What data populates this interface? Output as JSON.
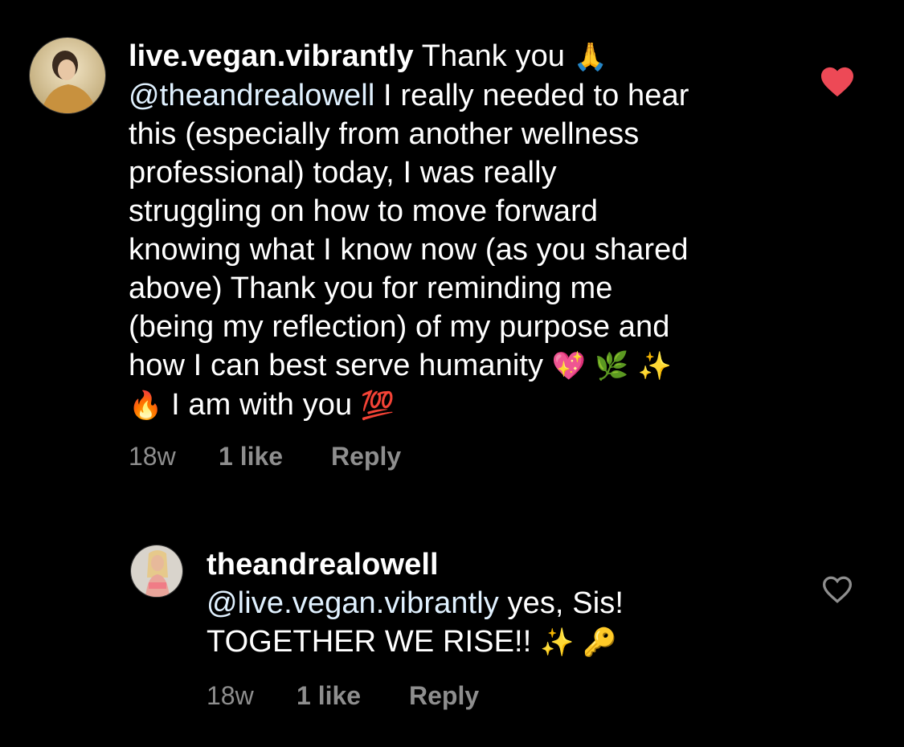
{
  "comments": [
    {
      "username": "live.vegan.vibrantly",
      "lines": [
        [
          "Thank you ",
          "🙏"
        ],
        [
          "@theandrealowell",
          " I really needed to hear"
        ],
        [
          "this (especially from another wellness"
        ],
        [
          "professional) today, I was really"
        ],
        [
          "struggling on how to move forward"
        ],
        [
          "knowing what I know now (as you shared"
        ],
        [
          "above) Thank you for reminding me"
        ],
        [
          "(being my reflection) of my purpose and"
        ],
        [
          "how I can best serve humanity ",
          "💖 🌿 ✨"
        ],
        [
          "🔥",
          " I am with you ",
          "💯"
        ]
      ],
      "time": "18w",
      "likes": "1 like",
      "reply": "Reply",
      "liked": true
    },
    {
      "username": "theandrealowell",
      "mention": "@live.vegan.vibrantly",
      "text_after_mention": " yes, Sis!",
      "line2": "TOGETHER WE RISE!! ",
      "line2_emoji": "✨ 🔑",
      "time": "18w",
      "likes": "1 like",
      "reply": "Reply",
      "liked": false
    }
  ],
  "colors": {
    "background": "#000000",
    "text": "#ffffff",
    "meta": "#8e8e8e",
    "heart_liked": "#ed4956",
    "mention": "#e0f1ff"
  }
}
